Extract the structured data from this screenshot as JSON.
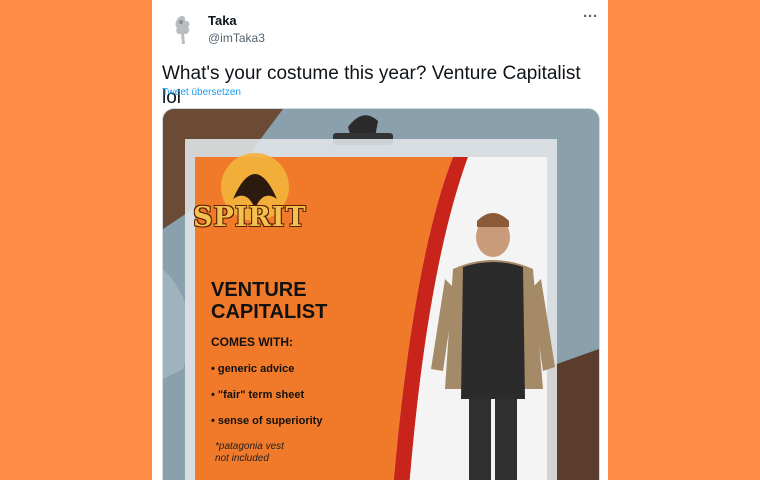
{
  "tweet": {
    "author_name": "Taka",
    "author_handle": "@imTaka3",
    "text": "What's your costume this year? Venture Capitalist lol",
    "translate_label": "Tweet übersetzen",
    "more_icon": "more-horizontal-icon"
  },
  "image": {
    "brand": "SPIRIT",
    "title_line1": "VENTURE",
    "title_line2": "CAPITALIST",
    "comes_with_label": "COMES WITH:",
    "items": [
      "• generic advice",
      "• \"fair\" term sheet",
      "• sense of superiority"
    ],
    "note_line1": "*patagonia vest",
    "note_line2": "not included"
  },
  "colors": {
    "page_bg": "#FF8C45",
    "link_blue": "#1d9bf0",
    "package_orange": "#f07a2a"
  }
}
